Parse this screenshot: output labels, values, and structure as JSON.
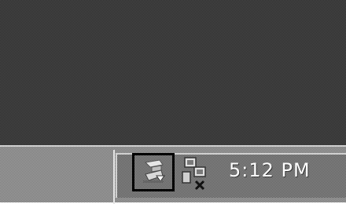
{
  "clock": {
    "time": "5:12 PM"
  },
  "tray": {
    "icons": [
      {
        "name": "usb-safely-remove-icon",
        "highlighted": true
      },
      {
        "name": "network-disconnected-icon",
        "highlighted": false
      }
    ]
  },
  "colors": {
    "desktop": "#3a3a3a",
    "taskbar": "#8c8c8c",
    "highlight": "#000000",
    "clock_text": "#ffffff"
  }
}
